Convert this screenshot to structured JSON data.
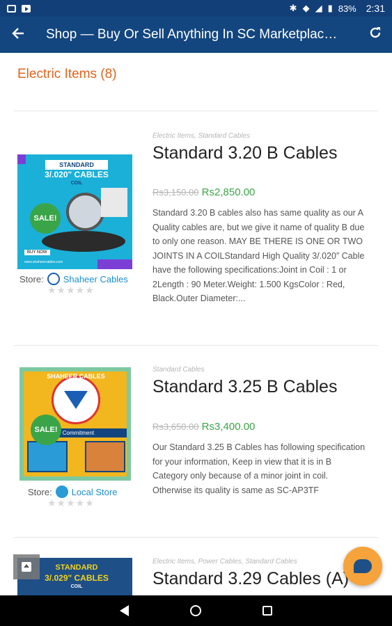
{
  "status_bar": {
    "battery": "83%",
    "time": "2:31"
  },
  "app_bar": {
    "title": "Shop — Buy Or Sell Anything In SC Marketplace - ..."
  },
  "category": {
    "title": "Electric Items (8)"
  },
  "products": [
    {
      "categories": "Electric Items, Standard Cables",
      "title": "Standard 3.20 B Cables",
      "old_price": "Rs3,150.00",
      "price": "Rs2,850.00",
      "description": "Standard 3.20 B cables also has same quality as our A Quality cables are, but we give it name of quality B due to only one reason. MAY BE THERE IS ONE OR TWO JOINTS IN A COILStandard High Quality 3/.020” Cable have the following specifications:Joint in Coil : 1 or 2Length : 90 Meter.Weight: 1.500 KgsColor : Red, Black.Outer Diameter:...",
      "store_label": "Store:",
      "store_name": "Shaheer Cables",
      "sale_badge": "SALE!",
      "image_text": [
        "STANDARD",
        "3/.020\" CABLES",
        "COIL",
        "BUY NOW",
        "www.shaheercables.com"
      ]
    },
    {
      "categories": "Standard Cables",
      "title": "Standard 3.25 B Cables",
      "old_price": "Rs3,650.00",
      "price": "Rs3,400.00",
      "description": "Our Standard 3.25 B Cables has following specification for your information, Keep in view that it is in B Category only because of a minor joint in coil. Otherwise its quality is same as SC-AP3TF",
      "store_label": "Store:",
      "store_name": "Local Store",
      "sale_badge": "SALE!",
      "image_text": [
        "SHAHEER CABLES",
        "s Our Commitment"
      ]
    },
    {
      "categories": "Electric Items, Power Cables, Standard Cables",
      "title": "Standard 3.29 Cables (A)",
      "image_text": [
        "STANDARD",
        "3/.029\" CABLES",
        "COIL"
      ]
    }
  ],
  "colors": {
    "app_bar": "#13467f",
    "category_title": "#e0621c",
    "price_new": "#3aa548",
    "store_link": "#1a8fd1",
    "chat_button": "#f5a33a"
  },
  "icons": {
    "back": "arrow-left-icon",
    "refresh": "refresh-icon",
    "chat": "chat-icon",
    "scroll_top": "scroll-top-icon"
  }
}
